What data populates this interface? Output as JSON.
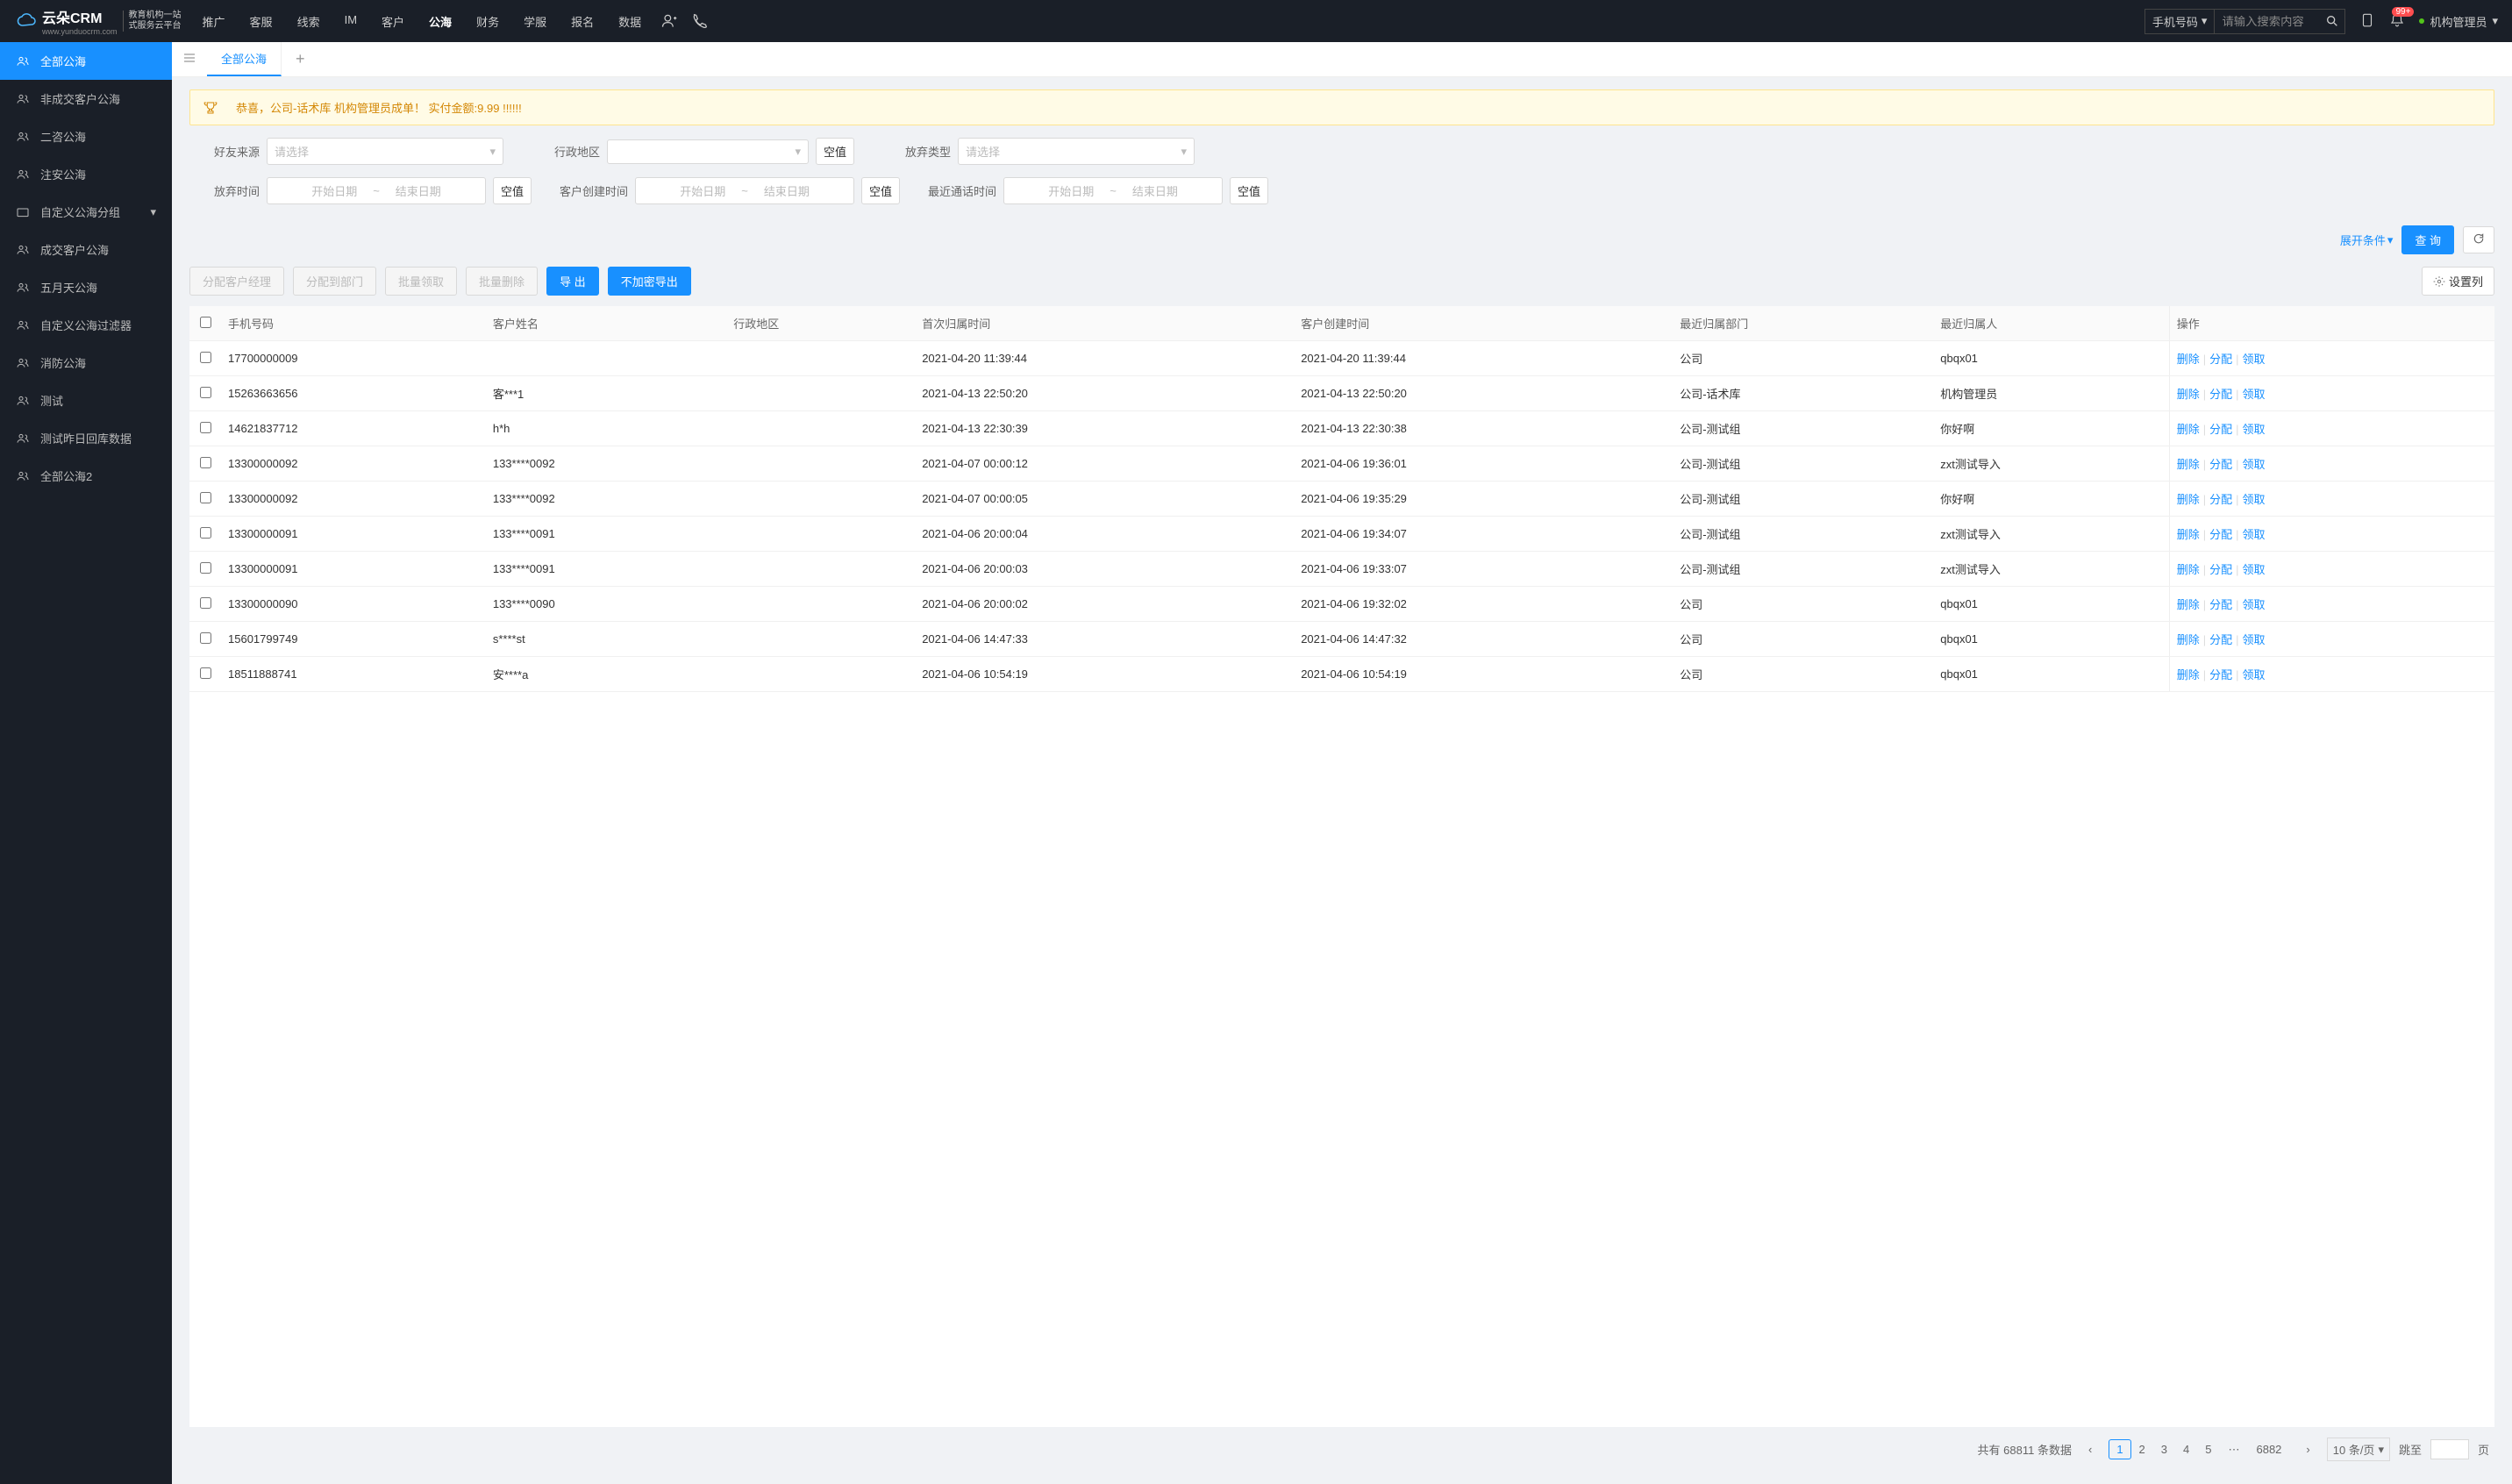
{
  "logo": {
    "brand": "云朵CRM",
    "domain": "www.yunduocrm.com",
    "tag1": "教育机构一站",
    "tag2": "式服务云平台"
  },
  "nav": [
    "推广",
    "客服",
    "线索",
    "IM",
    "客户",
    "公海",
    "财务",
    "学服",
    "报名",
    "数据"
  ],
  "nav_active": 5,
  "search": {
    "type": "手机号码",
    "placeholder": "请输入搜索内容"
  },
  "badge": "99+",
  "user": "机构管理员",
  "sidebar": [
    {
      "label": "全部公海",
      "active": true,
      "icon": "users"
    },
    {
      "label": "非成交客户公海",
      "icon": "users"
    },
    {
      "label": "二咨公海",
      "icon": "users"
    },
    {
      "label": "注安公海",
      "icon": "users"
    },
    {
      "label": "自定义公海分组",
      "icon": "folder",
      "expandable": true
    },
    {
      "label": "成交客户公海",
      "icon": "users"
    },
    {
      "label": "五月天公海",
      "icon": "users"
    },
    {
      "label": "自定义公海过滤器",
      "icon": "users"
    },
    {
      "label": "消防公海",
      "icon": "users"
    },
    {
      "label": "测试",
      "icon": "users"
    },
    {
      "label": "测试昨日回库数据",
      "icon": "users"
    },
    {
      "label": "全部公海2",
      "icon": "users"
    }
  ],
  "tab": "全部公海",
  "alert": "恭喜，公司-话术库  机构管理员成单！  实付金额:9.99 !!!!!!",
  "filters": {
    "friend_source": {
      "label": "好友来源",
      "placeholder": "请选择"
    },
    "region": {
      "label": "行政地区",
      "null": "空值"
    },
    "abandon_type": {
      "label": "放弃类型",
      "placeholder": "请选择"
    },
    "abandon_time": {
      "label": "放弃时间",
      "start": "开始日期",
      "end": "结束日期",
      "null": "空值"
    },
    "create_time": {
      "label": "客户创建时间",
      "start": "开始日期",
      "end": "结束日期",
      "null": "空值"
    },
    "call_time": {
      "label": "最近通话时间",
      "start": "开始日期",
      "end": "结束日期",
      "null": "空值"
    }
  },
  "expand": "展开条件",
  "query": "查 询",
  "buttons": {
    "assign_mgr": "分配客户经理",
    "assign_dept": "分配到部门",
    "batch_claim": "批量领取",
    "batch_del": "批量删除",
    "export": "导 出",
    "export_plain": "不加密导出",
    "settings": "设置列"
  },
  "columns": [
    "手机号码",
    "客户姓名",
    "行政地区",
    "首次归属时间",
    "客户创建时间",
    "最近归属部门",
    "最近归属人",
    "操作"
  ],
  "ops": {
    "del": "删除",
    "assign": "分配",
    "claim": "领取"
  },
  "rows": [
    {
      "phone": "17700000009",
      "name": "",
      "region": "",
      "first": "2021-04-20 11:39:44",
      "create": "2021-04-20 11:39:44",
      "dept": "公司",
      "owner": "qbqx01"
    },
    {
      "phone": "15263663656",
      "name": "客***1",
      "region": "",
      "first": "2021-04-13 22:50:20",
      "create": "2021-04-13 22:50:20",
      "dept": "公司-话术库",
      "owner": "机构管理员"
    },
    {
      "phone": "14621837712",
      "name": "h*h",
      "region": "",
      "first": "2021-04-13 22:30:39",
      "create": "2021-04-13 22:30:38",
      "dept": "公司-测试组",
      "owner": "你好啊"
    },
    {
      "phone": "13300000092",
      "name": "133****0092",
      "region": "",
      "first": "2021-04-07 00:00:12",
      "create": "2021-04-06 19:36:01",
      "dept": "公司-测试组",
      "owner": "zxt测试导入"
    },
    {
      "phone": "13300000092",
      "name": "133****0092",
      "region": "",
      "first": "2021-04-07 00:00:05",
      "create": "2021-04-06 19:35:29",
      "dept": "公司-测试组",
      "owner": "你好啊"
    },
    {
      "phone": "13300000091",
      "name": "133****0091",
      "region": "",
      "first": "2021-04-06 20:00:04",
      "create": "2021-04-06 19:34:07",
      "dept": "公司-测试组",
      "owner": "zxt测试导入"
    },
    {
      "phone": "13300000091",
      "name": "133****0091",
      "region": "",
      "first": "2021-04-06 20:00:03",
      "create": "2021-04-06 19:33:07",
      "dept": "公司-测试组",
      "owner": "zxt测试导入"
    },
    {
      "phone": "13300000090",
      "name": "133****0090",
      "region": "",
      "first": "2021-04-06 20:00:02",
      "create": "2021-04-06 19:32:02",
      "dept": "公司",
      "owner": "qbqx01"
    },
    {
      "phone": "15601799749",
      "name": "s****st",
      "region": "",
      "first": "2021-04-06 14:47:33",
      "create": "2021-04-06 14:47:32",
      "dept": "公司",
      "owner": "qbqx01"
    },
    {
      "phone": "18511888741",
      "name": "安****a",
      "region": "",
      "first": "2021-04-06 10:54:19",
      "create": "2021-04-06 10:54:19",
      "dept": "公司",
      "owner": "qbqx01"
    }
  ],
  "pager": {
    "total_text": "共有 68811 条数据",
    "pages": [
      "1",
      "2",
      "3",
      "4",
      "5"
    ],
    "ellipsis": "⋯",
    "last": "6882",
    "size": "10 条/页",
    "jump": "跳至",
    "page_suffix": "页"
  }
}
